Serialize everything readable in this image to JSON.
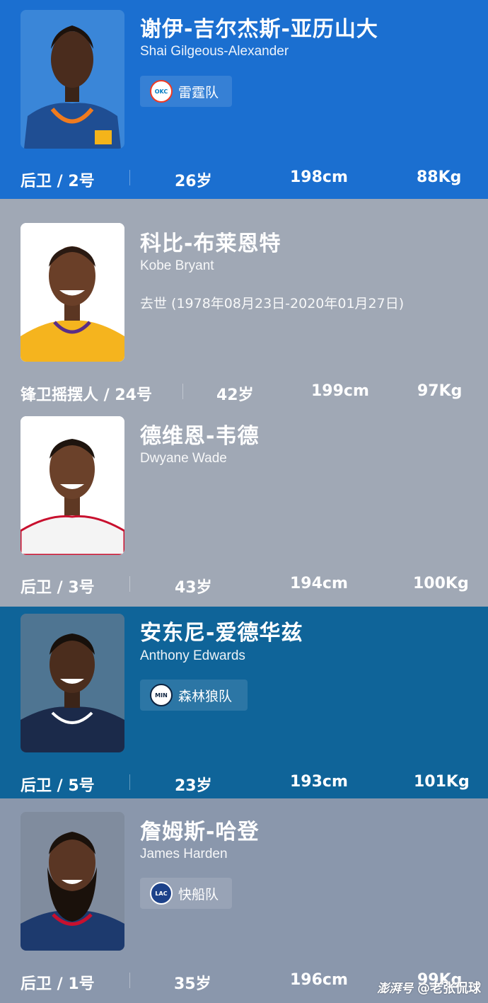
{
  "colors": {
    "card1_bg": "#1b6fd0",
    "card2_bg": "#a0a8b5",
    "card3_bg": "#a0a8b5",
    "card4_bg": "#0f6499",
    "card5_bg": "#8a97ac"
  },
  "players": [
    {
      "name_cn": "谢伊-吉尔杰斯-亚历山大",
      "name_en": "Shai Gilgeous-Alexander",
      "team": "雷霆队",
      "team_logo_text": "OKC",
      "position": "后卫 / 2号",
      "age": "26岁",
      "height": "198cm",
      "weight": "88Kg"
    },
    {
      "name_cn": "科比-布莱恩特",
      "name_en": "Kobe Bryant",
      "note": "去世 (1978年08月23日-2020年01月27日)",
      "position": "锋卫摇摆人 / 24号",
      "age": "42岁",
      "height": "199cm",
      "weight": "97Kg"
    },
    {
      "name_cn": "德维恩-韦德",
      "name_en": "Dwyane Wade",
      "position": "后卫 / 3号",
      "age": "43岁",
      "height": "194cm",
      "weight": "100Kg"
    },
    {
      "name_cn": "安东尼-爱德华兹",
      "name_en": "Anthony Edwards",
      "team": "森林狼队",
      "team_logo_text": "MIN",
      "position": "后卫 / 5号",
      "age": "23岁",
      "height": "193cm",
      "weight": "101Kg"
    },
    {
      "name_cn": "詹姆斯-哈登",
      "name_en": "James Harden",
      "team": "快船队",
      "team_logo_text": "LAC",
      "position": "后卫 / 1号",
      "age": "35岁",
      "height": "196cm",
      "weight": "99Kg"
    }
  ],
  "watermark": {
    "brand": "澎湃号",
    "handle": "@老张侃球"
  }
}
